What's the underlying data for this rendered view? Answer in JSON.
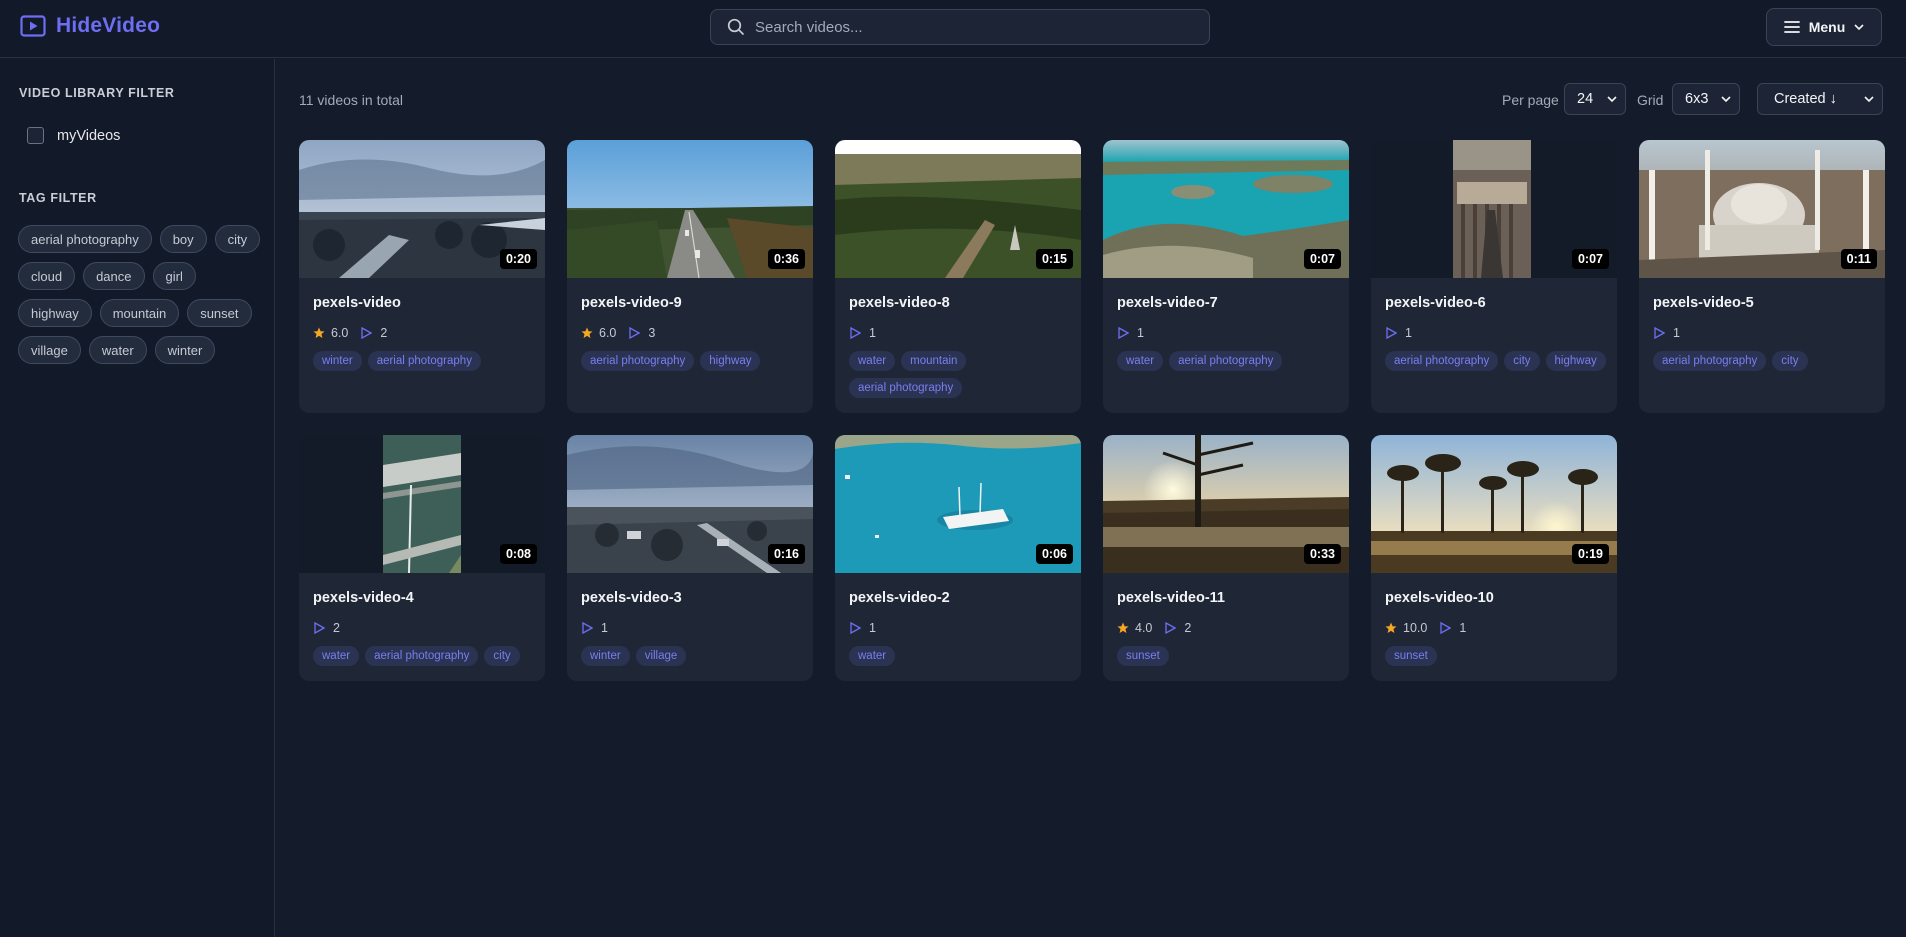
{
  "app": {
    "name": "HideVideo",
    "accent": "#6d6ef2"
  },
  "search": {
    "placeholder": "Search videos..."
  },
  "menu": {
    "label": "Menu"
  },
  "sidebar": {
    "library_title": "VIDEO LIBRARY FILTER",
    "library_option": "myVideos",
    "tag_title": "TAG FILTER",
    "tags": [
      "aerial photography",
      "boy",
      "city",
      "cloud",
      "dance",
      "girl",
      "highway",
      "mountain",
      "sunset",
      "village",
      "water",
      "winter"
    ]
  },
  "toolbar": {
    "total": "11 videos in total",
    "per_page_label": "Per page",
    "per_page_value": "24",
    "grid_label": "Grid",
    "grid_value": "6x3",
    "sort_value": "Created ↓"
  },
  "videos": [
    {
      "title": "pexels-video",
      "duration": "0:20",
      "rating": "6.0",
      "plays": "2",
      "tags": [
        "winter",
        "aerial photography"
      ]
    },
    {
      "title": "pexels-video-9",
      "duration": "0:36",
      "rating": "6.0",
      "plays": "3",
      "tags": [
        "aerial photography",
        "highway"
      ]
    },
    {
      "title": "pexels-video-8",
      "duration": "0:15",
      "rating": null,
      "plays": "1",
      "tags": [
        "water",
        "mountain",
        "aerial photography"
      ]
    },
    {
      "title": "pexels-video-7",
      "duration": "0:07",
      "rating": null,
      "plays": "1",
      "tags": [
        "water",
        "aerial photography"
      ]
    },
    {
      "title": "pexels-video-6",
      "duration": "0:07",
      "rating": null,
      "plays": "1",
      "tags": [
        "aerial photography",
        "city",
        "highway"
      ]
    },
    {
      "title": "pexels-video-5",
      "duration": "0:11",
      "rating": null,
      "plays": "1",
      "tags": [
        "aerial photography",
        "city"
      ]
    },
    {
      "title": "pexels-video-4",
      "duration": "0:08",
      "rating": null,
      "plays": "2",
      "tags": [
        "water",
        "aerial photography",
        "city"
      ]
    },
    {
      "title": "pexels-video-3",
      "duration": "0:16",
      "rating": null,
      "plays": "1",
      "tags": [
        "winter",
        "village"
      ]
    },
    {
      "title": "pexels-video-2",
      "duration": "0:06",
      "rating": null,
      "plays": "1",
      "tags": [
        "water"
      ]
    },
    {
      "title": "pexels-video-11",
      "duration": "0:33",
      "rating": "4.0",
      "plays": "2",
      "tags": [
        "sunset"
      ]
    },
    {
      "title": "pexels-video-10",
      "duration": "0:19",
      "rating": "10.0",
      "plays": "1",
      "tags": [
        "sunset"
      ]
    }
  ]
}
